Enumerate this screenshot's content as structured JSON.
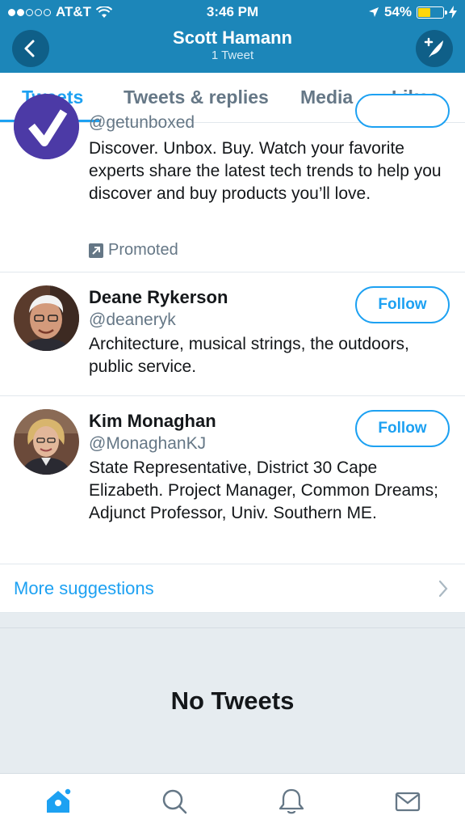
{
  "status_bar": {
    "carrier": "AT&T",
    "time": "3:46 PM",
    "battery": "54%",
    "battery_level": 0.54
  },
  "nav": {
    "title": "Scott Hamann",
    "subtitle": "1 Tweet"
  },
  "tabs": [
    {
      "label": "Tweets",
      "active": true
    },
    {
      "label": "Tweets & replies",
      "active": false
    },
    {
      "label": "Media",
      "active": false
    },
    {
      "label": "Likes",
      "active": false
    }
  ],
  "suggestions": [
    {
      "handle": "@getunboxed",
      "bio": "Discover. Unbox. Buy. Watch your favorite experts share the latest tech trends to help you discover and buy products you’ll love.",
      "promoted_label": "Promoted"
    },
    {
      "name": "Deane Rykerson",
      "handle": "@deaneryk",
      "bio": "Architecture, musical strings, the outdoors, public service.",
      "follow_label": "Follow"
    },
    {
      "name": "Kim Monaghan",
      "handle": "@MonaghanKJ",
      "bio": "State Representative, District 30 Cape Elizabeth. Project Manager, Common Dreams; Adjunct Professor, Univ. Southern ME.",
      "follow_label": "Follow"
    }
  ],
  "more_suggestions": "More suggestions",
  "empty_state": "No Tweets",
  "bottom_nav": [
    "home-icon",
    "search-icon",
    "notifications-icon",
    "messages-icon"
  ],
  "colors": {
    "header": "#1c86b9",
    "accent": "#1da1f2",
    "secondary_text": "#657786"
  }
}
